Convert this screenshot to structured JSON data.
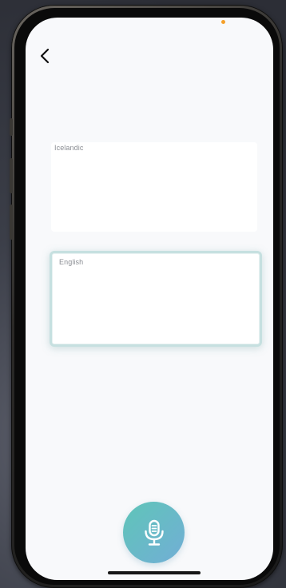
{
  "navigation": {
    "back_icon": "chevron-left-icon"
  },
  "source_card": {
    "language_label": "Icelandic",
    "text": ""
  },
  "target_card": {
    "language_label": "English",
    "text": ""
  },
  "mic": {
    "icon": "microphone-icon"
  },
  "colors": {
    "screen_background": "#f8f9fb",
    "accent_teal": "#5fc5b8",
    "accent_blue": "#72aed6",
    "target_card_border": "#c6e0e0",
    "status_dot": "#f5a02a"
  }
}
